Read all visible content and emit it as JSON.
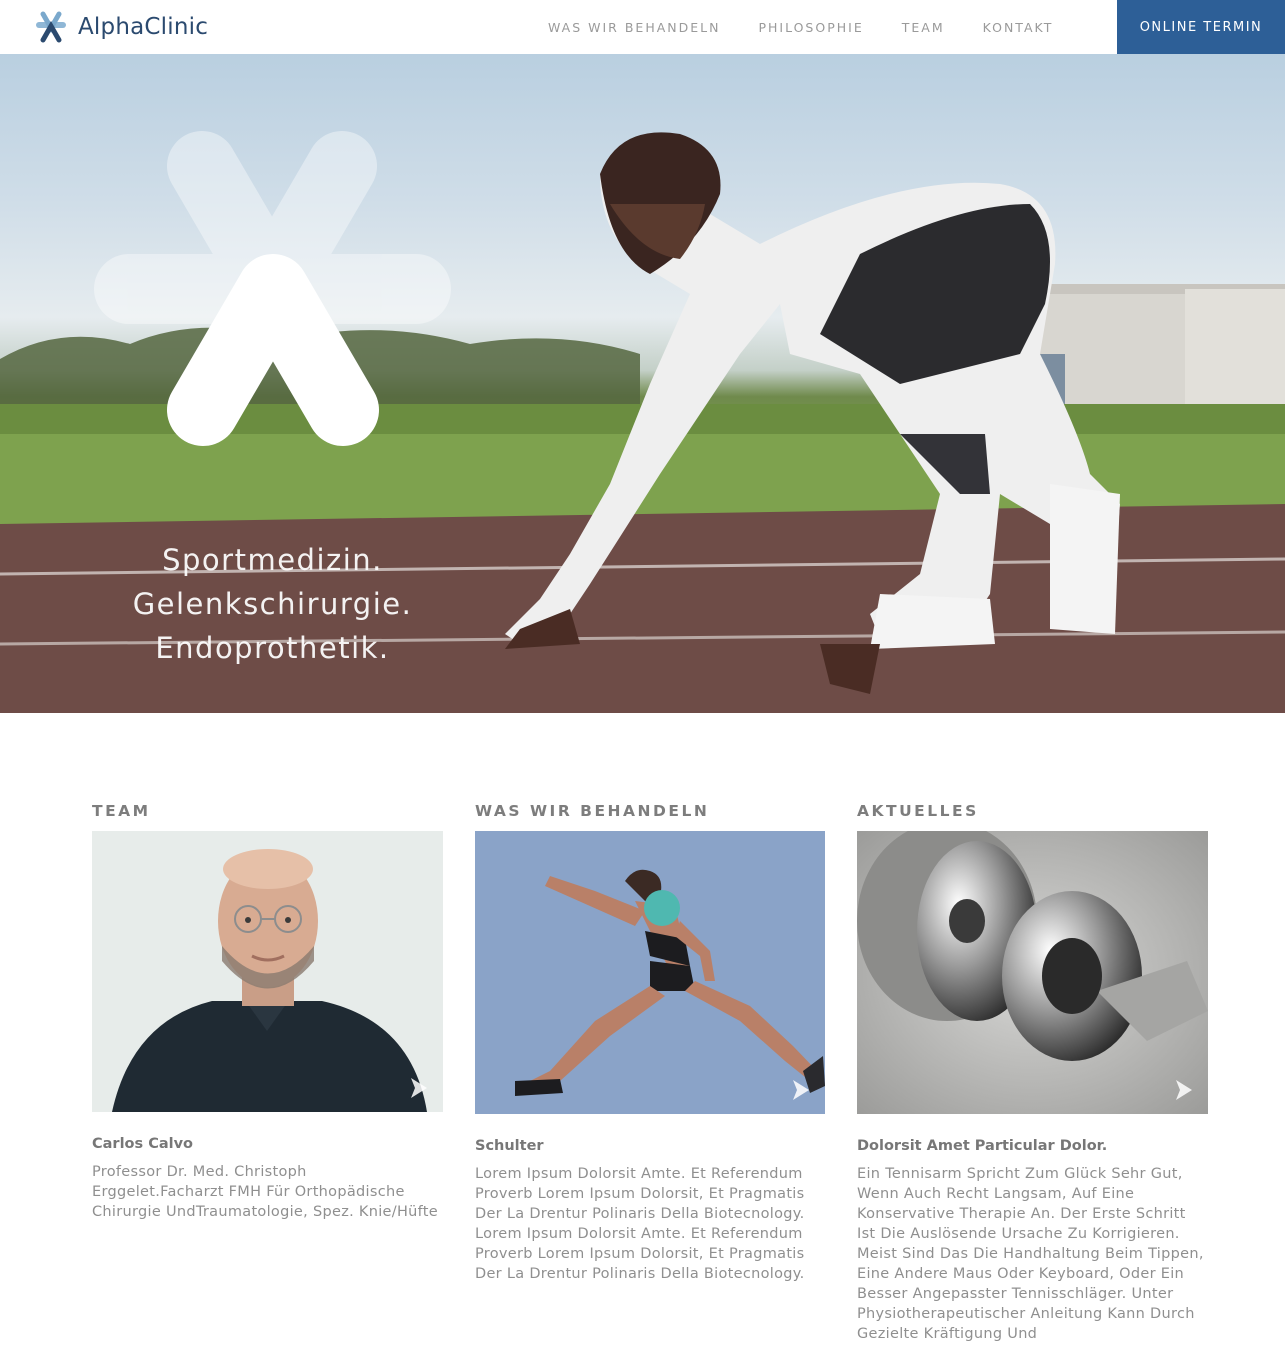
{
  "brand": {
    "name": "AlphaClinic",
    "primary_color": "#2d5f97",
    "logo_color": "#2b4a6f"
  },
  "nav": {
    "items": [
      {
        "label": "WAS WIR BEHANDELN"
      },
      {
        "label": "PHILOSOPHIE"
      },
      {
        "label": "TEAM"
      },
      {
        "label": "KONTAKT"
      }
    ],
    "cta_label": "ONLINE TERMIN"
  },
  "hero": {
    "lines": [
      "Sportmedizin.",
      "Gelenkschirurgie.",
      "Endoprothetik."
    ],
    "icon": "alpha-cross-logo-icon"
  },
  "sections": [
    {
      "title": "TEAM",
      "heading": "Carlos Calvo",
      "body": "Professor Dr. Med. Christoph Erggelet.Facharzt FMH Für Orthopädische Chirurgie UndTraumatologie, Spez. Knie/Hüfte"
    },
    {
      "title": "WAS WIR BEHANDELN",
      "heading": "Schulter",
      "body": "Lorem Ipsum Dolorsit Amte. Et Referendum Proverb Lorem Ipsum Dolorsit, Et Pragmatis Der La Drentur Polinaris Della Biotecnology. Lorem Ipsum Dolorsit Amte. Et Referendum Proverb Lorem Ipsum Dolorsit, Et Pragmatis Der La Drentur Polinaris Della Biotecnology."
    },
    {
      "title": "AKTUELLES",
      "heading": "Dolorsit Amet Particular Dolor.",
      "body": "Ein Tennisarm Spricht Zum Glück Sehr Gut, Wenn Auch Recht Langsam, Auf Eine Konservative Therapie An. Der Erste Schritt Ist Die Auslösende Ursache Zu Korrigieren. Meist Sind Das Die Handhaltung Beim Tippen, Eine Andere Maus Oder Keyboard, Oder Ein Besser Angepasster Tennisschläger. Unter Physiotherapeutischer Anleitung Kann Durch Gezielte Kräftigung Und"
    }
  ],
  "icons": {
    "card_arrow": "chevron-right-icon",
    "shoulder_marker": "highlight-dot-icon",
    "marker_color": "#4fb8b0"
  }
}
